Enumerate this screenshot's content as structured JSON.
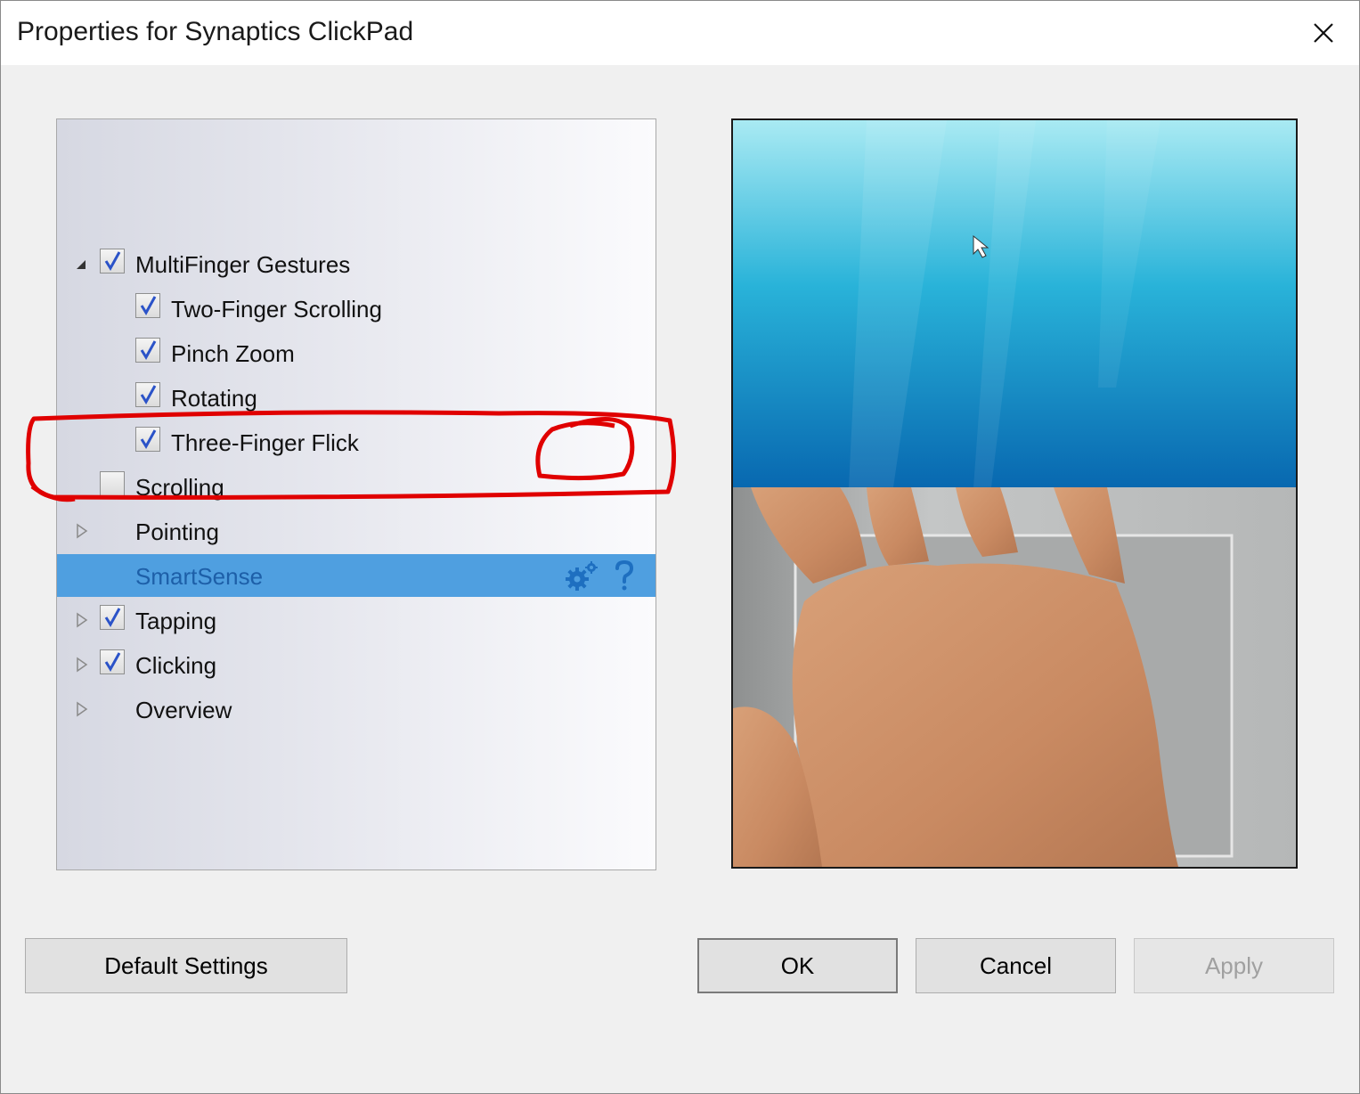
{
  "window": {
    "title": "Properties for Synaptics ClickPad"
  },
  "tree": {
    "items": [
      {
        "label": "MultiFinger Gestures",
        "checked": true,
        "expander": "expanded"
      },
      {
        "label": "Two-Finger Scrolling",
        "checked": true,
        "expander": "none"
      },
      {
        "label": "Pinch Zoom",
        "checked": true,
        "expander": "none"
      },
      {
        "label": "Rotating",
        "checked": true,
        "expander": "none"
      },
      {
        "label": "Three-Finger Flick",
        "checked": true,
        "expander": "none"
      },
      {
        "label": "Scrolling",
        "checked": false,
        "expander": "none"
      },
      {
        "label": "Pointing",
        "checked": null,
        "expander": "collapsed"
      },
      {
        "label": "SmartSense",
        "checked": null,
        "expander": "none",
        "selected": true,
        "icons": [
          "gear-icon",
          "help-icon"
        ]
      },
      {
        "label": "Tapping",
        "checked": true,
        "expander": "collapsed"
      },
      {
        "label": "Clicking",
        "checked": true,
        "expander": "collapsed"
      },
      {
        "label": "Overview",
        "checked": null,
        "expander": "collapsed"
      }
    ]
  },
  "buttons": {
    "default_settings": "Default Settings",
    "ok": "OK",
    "cancel": "Cancel",
    "apply": "Apply"
  },
  "colors": {
    "selection": "#4f9fe0",
    "selected_text": "#1d5fa8",
    "annotation": "#e00000"
  }
}
